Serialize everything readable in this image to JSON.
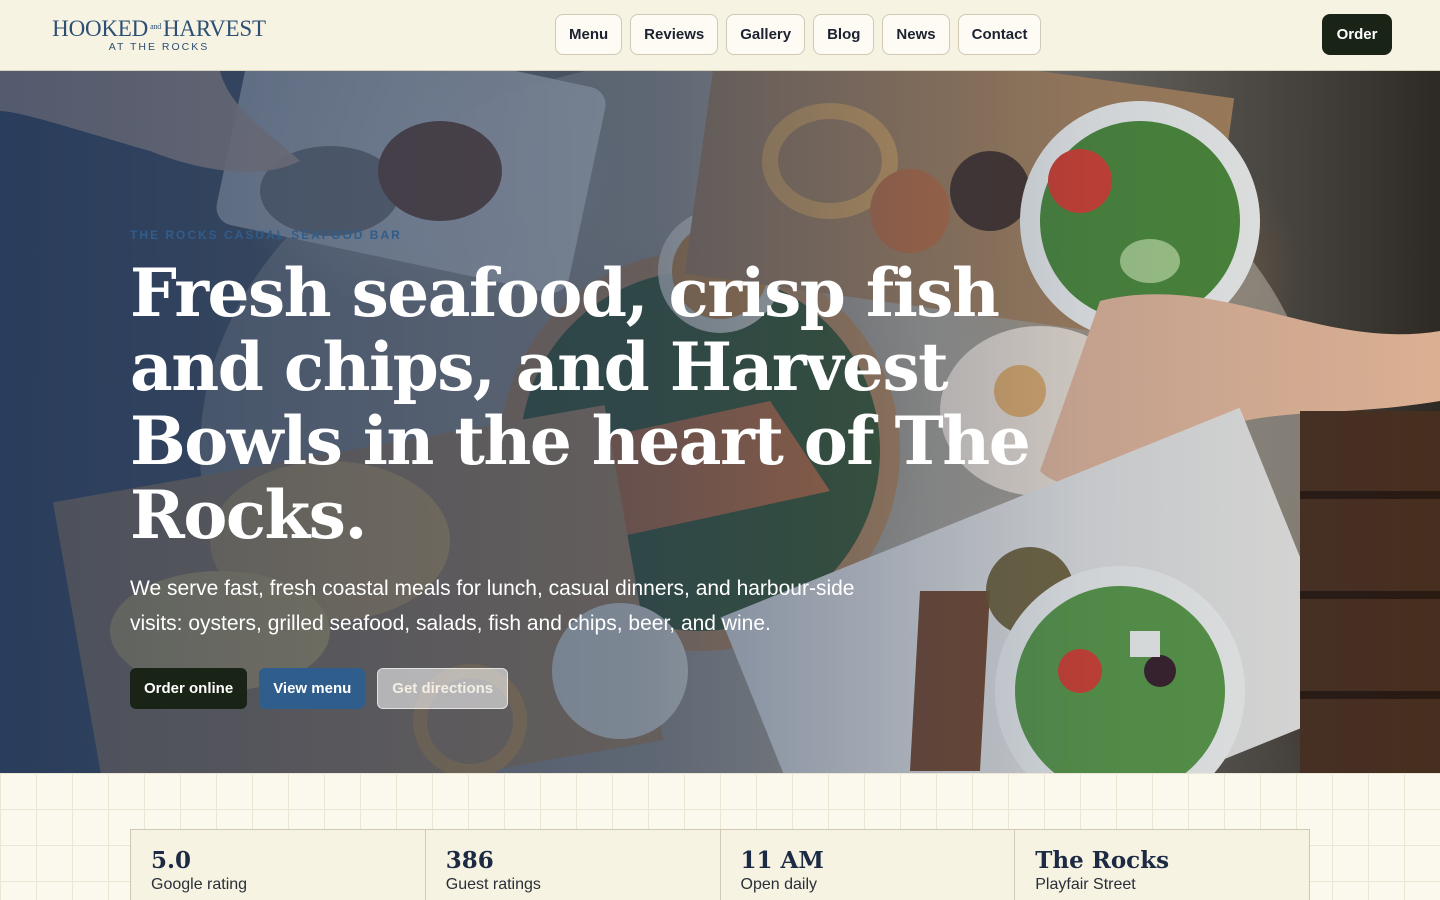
{
  "header": {
    "logo": {
      "main_left": "HOOKED",
      "main_and": "and",
      "main_right": "HARVEST",
      "sub": "AT THE ROCKS"
    },
    "nav": [
      "Menu",
      "Reviews",
      "Gallery",
      "Blog",
      "News",
      "Contact"
    ],
    "order_label": "Order"
  },
  "hero": {
    "eyebrow": "THE ROCKS CASUAL SEAFOOD BAR",
    "headline": "Fresh seafood, crisp fish and chips, and Harvest Bowls in the heart of The Rocks.",
    "subtext": "We serve fast, fresh coastal meals for lunch, casual dinners, and harbour-side visits: oysters, grilled seafood, salads, fish and chips, beer, and wine.",
    "cta": {
      "order_online": "Order online",
      "view_menu": "View menu",
      "get_directions": "Get directions"
    }
  },
  "stats": [
    {
      "value": "5.0",
      "label": "Google rating"
    },
    {
      "value": "386",
      "label": "Guest ratings"
    },
    {
      "value": "11 AM",
      "label": "Open daily"
    },
    {
      "value": "The Rocks",
      "label": "Playfair Street"
    }
  ],
  "colors": {
    "brand_blue": "#2f5d8c",
    "dark": "#1a2416",
    "cream": "#f7f3e3"
  }
}
